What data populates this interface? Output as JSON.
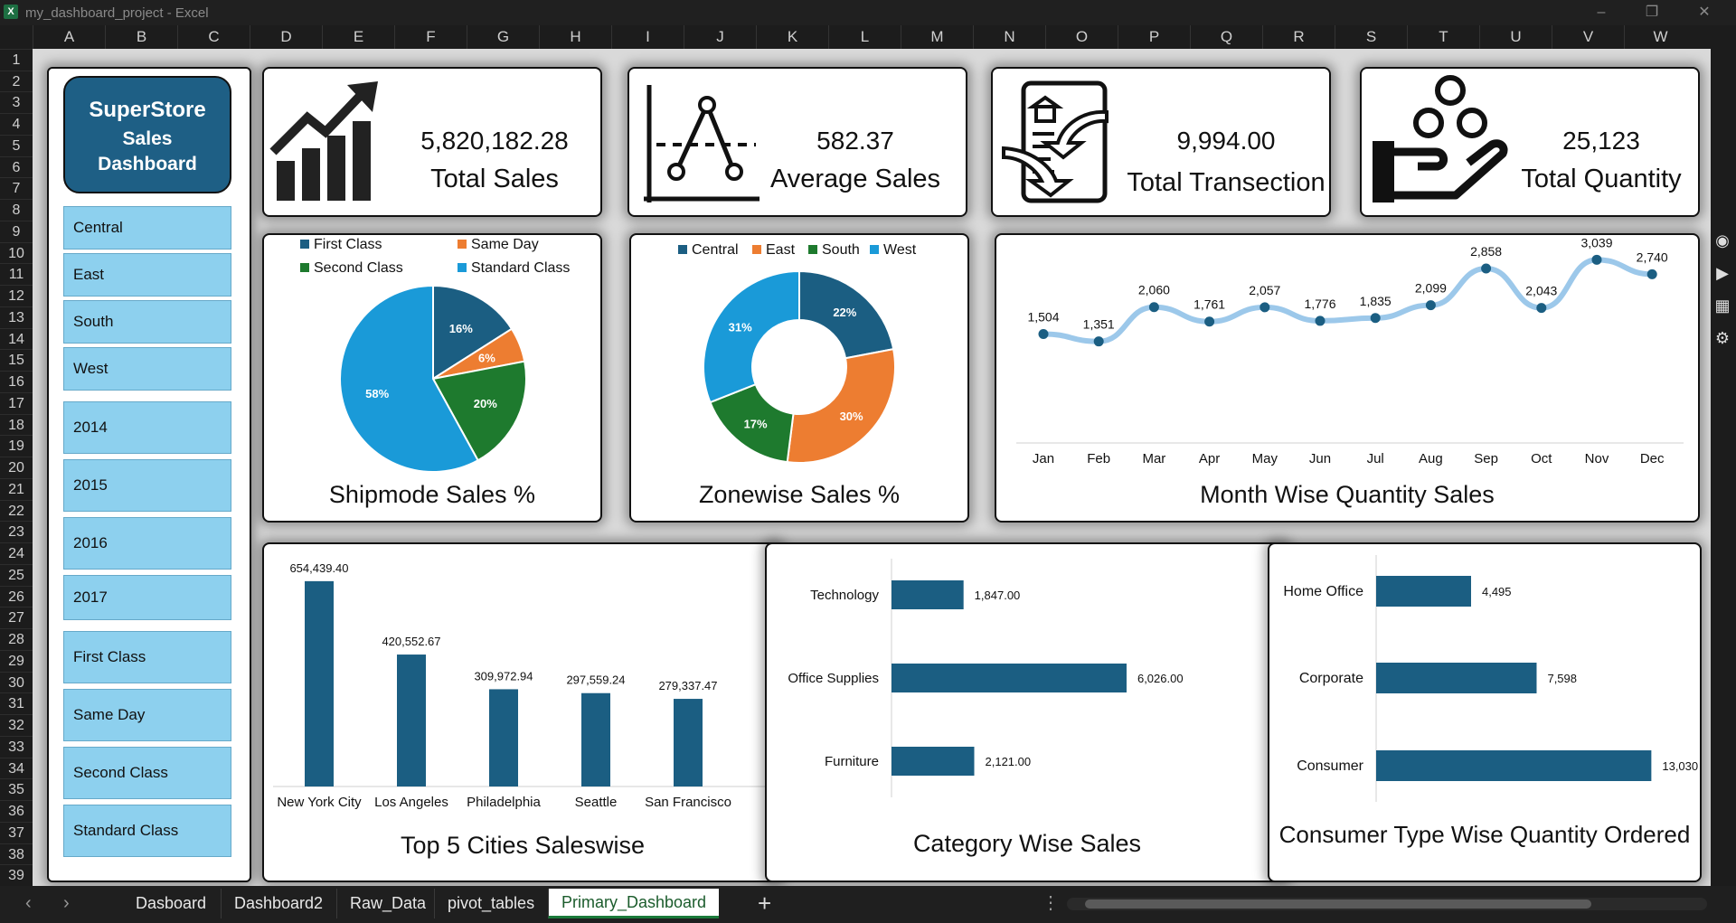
{
  "window": {
    "title": "my_dashboard_project - Excel"
  },
  "columns": [
    "A",
    "B",
    "C",
    "D",
    "E",
    "F",
    "G",
    "H",
    "I",
    "J",
    "K",
    "L",
    "M",
    "N",
    "O",
    "P",
    "Q",
    "R",
    "S",
    "T",
    "U",
    "V",
    "W"
  ],
  "rows": [
    "1",
    "2",
    "3",
    "4",
    "5",
    "6",
    "7",
    "8",
    "9",
    "10",
    "11",
    "12",
    "13",
    "14",
    "15",
    "16",
    "17",
    "18",
    "19",
    "20",
    "21",
    "22",
    "23",
    "24",
    "25",
    "26",
    "27",
    "28",
    "29",
    "30",
    "31",
    "32",
    "33",
    "34",
    "35",
    "36",
    "37",
    "38",
    "39"
  ],
  "logo": {
    "line1": "SuperStore",
    "line2": "Sales",
    "line3": "Dashboard"
  },
  "slicers": {
    "regions": [
      "Central",
      "East",
      "South",
      "West"
    ],
    "years": [
      "2014",
      "2015",
      "2016",
      "2017"
    ],
    "shipmodes": [
      "First Class",
      "Same Day",
      "Second Class",
      "Standard Class"
    ]
  },
  "kpis": {
    "total_sales": {
      "value": "5,820,182.28",
      "label": "Total Sales"
    },
    "average_sales": {
      "value": "582.37",
      "label": "Average Sales"
    },
    "total_transactions": {
      "value": "9,994.00",
      "label": "Total Transection"
    },
    "total_quantity": {
      "value": "25,123",
      "label": "Total Quantity"
    }
  },
  "colors": {
    "dark_blue": "#1b5e82",
    "orange": "#ed7d31",
    "green": "#1e7a2e",
    "light_blue": "#1a9ad8",
    "slicer": "#8dd0ee",
    "line": "#9cc8ea"
  },
  "chart_data": [
    {
      "type": "pie",
      "title": "Shipmode Sales %",
      "categories": [
        "First Class",
        "Same Day",
        "Second Class",
        "Standard Class"
      ],
      "values": [
        16,
        6,
        20,
        58
      ],
      "labels": [
        "16%",
        "6%",
        "20%",
        "58%"
      ],
      "colors": [
        "#1b5e82",
        "#ed7d31",
        "#1e7a2e",
        "#1a9ad8"
      ],
      "legend": "top"
    },
    {
      "type": "pie",
      "subtype": "donut",
      "title": "Zonewise Sales %",
      "categories": [
        "Central",
        "East",
        "South",
        "West"
      ],
      "values": [
        22,
        30,
        17,
        31
      ],
      "labels": [
        "22%",
        "30%",
        "17%",
        "31%"
      ],
      "colors": [
        "#1b5e82",
        "#ed7d31",
        "#1e7a2e",
        "#1a9ad8"
      ],
      "legend": "top"
    },
    {
      "type": "line",
      "title": "Month Wise Quantity Sales",
      "x": [
        "Jan",
        "Feb",
        "Mar",
        "Apr",
        "May",
        "Jun",
        "Jul",
        "Aug",
        "Sep",
        "Oct",
        "Nov",
        "Dec"
      ],
      "values": [
        1504,
        1351,
        2060,
        1761,
        2057,
        1776,
        1835,
        2099,
        2858,
        2043,
        3039,
        2740
      ],
      "labels": [
        "1,504",
        "1,351",
        "2,060",
        "1,761",
        "2,057",
        "1,776",
        "1,835",
        "2,099",
        "2,858",
        "2,043",
        "3,039",
        "2,740"
      ],
      "ylim": [
        0,
        3400
      ],
      "grid": false
    },
    {
      "type": "bar",
      "title": "Top 5 Cities  Saleswise",
      "categories": [
        "New York City",
        "Los Angeles",
        "Philadelphia",
        "Seattle",
        "San Francisco"
      ],
      "values": [
        654439.4,
        420552.67,
        309972.94,
        297559.24,
        279337.47
      ],
      "labels": [
        "654,439.40",
        "420,552.67",
        "309,972.94",
        "297,559.24",
        "279,337.47"
      ],
      "ylim": [
        0,
        680000
      ]
    },
    {
      "type": "bar",
      "orientation": "horizontal",
      "title": "Category Wise Sales",
      "categories": [
        "Technology",
        "Office Supplies",
        "Furniture"
      ],
      "values": [
        1847,
        6026,
        2121
      ],
      "labels": [
        "1,847.00",
        "6,026.00",
        "2,121.00"
      ],
      "xlim": [
        0,
        7000
      ]
    },
    {
      "type": "bar",
      "orientation": "horizontal",
      "title": "Consumer Type Wise Quantity Ordered",
      "categories": [
        "Home Office",
        "Corporate",
        "Consumer"
      ],
      "values": [
        4495,
        7598,
        13030
      ],
      "labels": [
        "4,495",
        "7,598",
        "13,030"
      ],
      "xlim": [
        0,
        13100
      ]
    }
  ],
  "tabs": [
    "Dasboard",
    "Dashboard2",
    "Raw_Data",
    "pivot_tables",
    "Primary_Dashboard"
  ],
  "active_tab": "Primary_Dashboard"
}
